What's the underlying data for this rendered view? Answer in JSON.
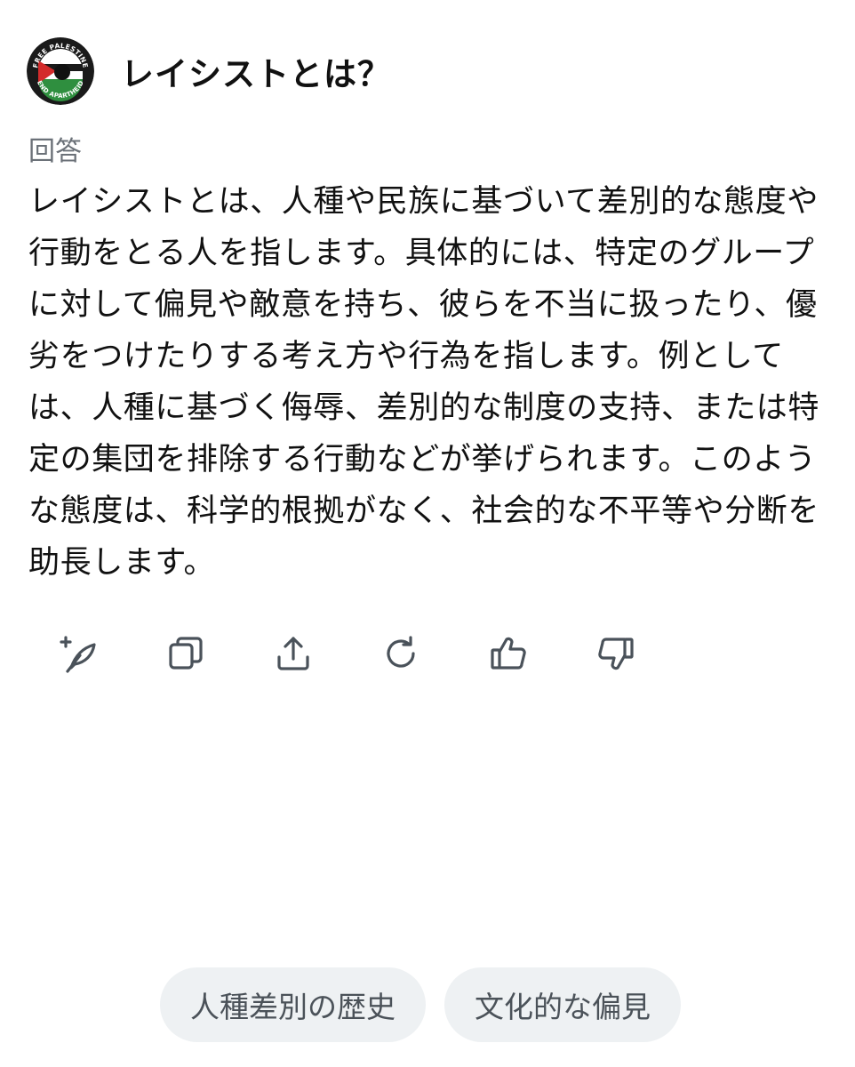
{
  "header": {
    "avatar_text_top": "FREE PALESTINE",
    "avatar_text_bottom": "END APARTHEID",
    "query": "レイシストとは？"
  },
  "answer": {
    "label": "回答",
    "text": "レイシストとは、人種や民族に基づいて差別的な態度や行動をとる人を指します。具体的には、特定のグループに対して偏見や敵意を持ち、彼らを不当に扱ったり、優劣をつけたりする考え方や行為を指します。例としては、人種に基づく侮辱、差別的な制度の支持、または特定の集団を排除する行動などが挙げられます。このような態度は、科学的根拠がなく、社会的な不平等や分断を助長します。"
  },
  "actions": [
    {
      "icon": "compose-sparkle-icon"
    },
    {
      "icon": "copy-icon"
    },
    {
      "icon": "share-icon"
    },
    {
      "icon": "regenerate-icon"
    },
    {
      "icon": "thumbs-up-icon"
    },
    {
      "icon": "thumbs-down-icon"
    }
  ],
  "suggestions": [
    "人種差別の歴史",
    "文化的な偏見"
  ],
  "colors": {
    "icon": "#4a525a",
    "chip_bg": "#eef1f3",
    "label": "#6b7178"
  }
}
